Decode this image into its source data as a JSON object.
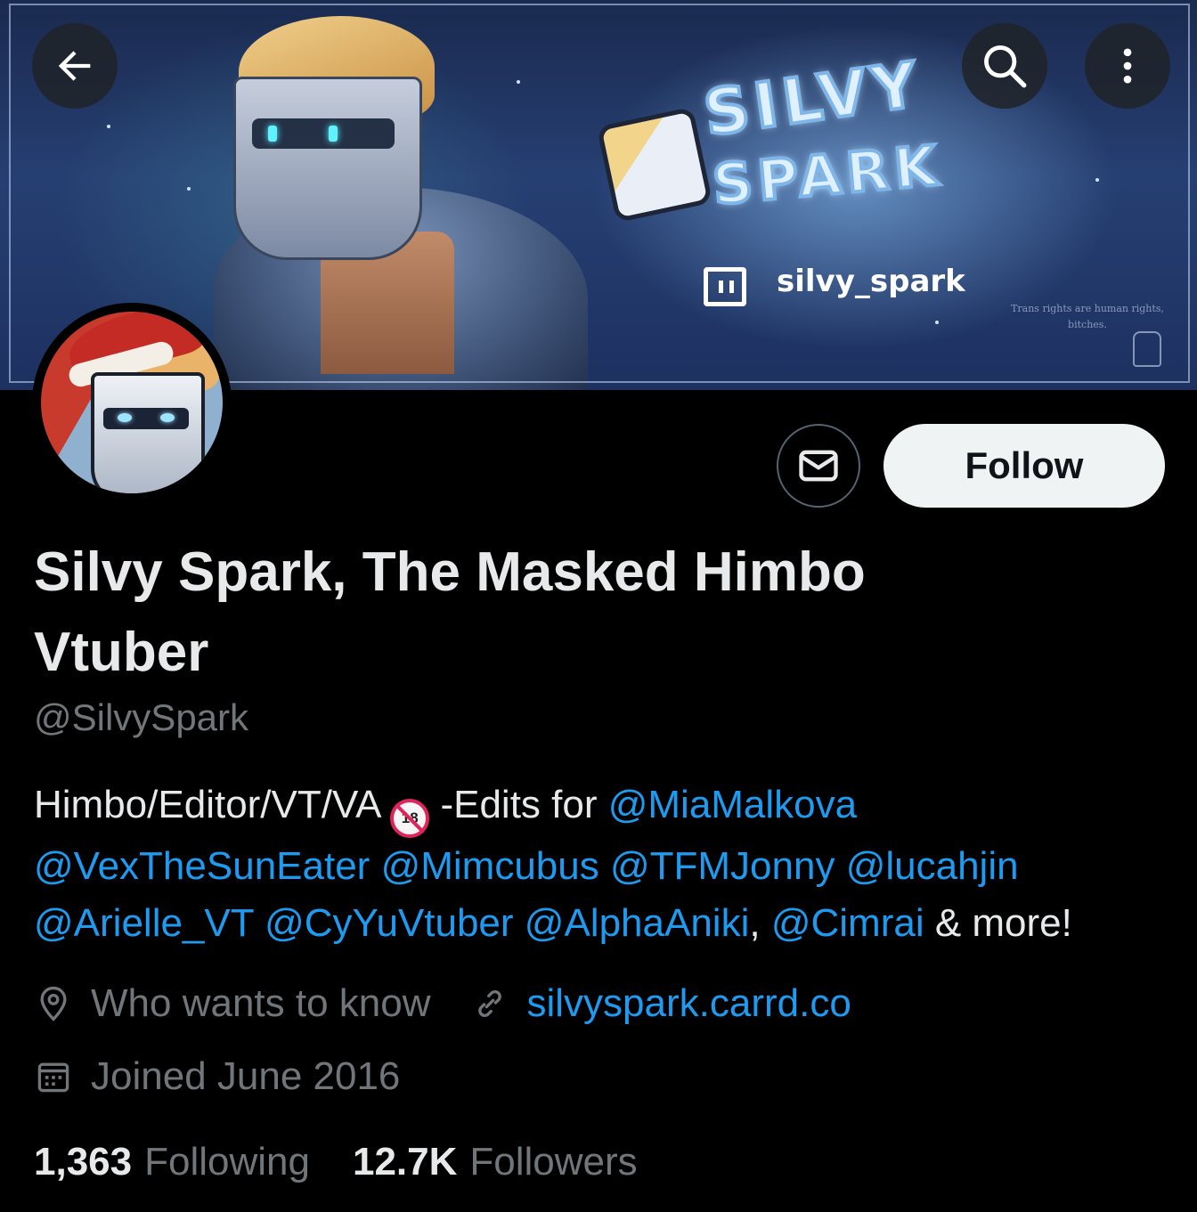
{
  "header": {
    "back_icon": "arrow-left-icon",
    "search_icon": "search-icon",
    "more_icon": "more-vertical-icon"
  },
  "banner": {
    "logo_line1": "SILVY",
    "logo_line2": "SPARK",
    "twitch_handle": "silvy_spark",
    "watermark_line1": "Trans rights are human rights,",
    "watermark_line2": "bitches."
  },
  "actions": {
    "message_icon": "mail-icon",
    "follow_label": "Follow"
  },
  "profile": {
    "display_name": "Silvy Spark, The Masked Himbo Vtuber",
    "handle": "@SilvySpark",
    "bio": {
      "prefix": "Himbo/Editor/VT/VA ",
      "badge": "18",
      "mid": " -Edits for ",
      "mentions": [
        "@MiaMalkova",
        "@VexTheSunEater",
        "@Mimcubus",
        "@TFMJonny",
        "@lucahjin",
        "@Arielle_VT",
        "@CyYuVtuber",
        "@AlphaAniki",
        "@Cimrai"
      ],
      "comma": ",",
      "suffix": " & more!"
    },
    "location": "Who wants to know",
    "website": "silvyspark.carrd.co",
    "joined": "Joined June 2016"
  },
  "stats": {
    "following_count": "1,363",
    "following_label": "Following",
    "followers_count": "12.7K",
    "followers_label": "Followers"
  },
  "colors": {
    "accent": "#1d9bf0",
    "muted": "#71767b",
    "text": "#e7e9ea",
    "background": "#000000"
  }
}
